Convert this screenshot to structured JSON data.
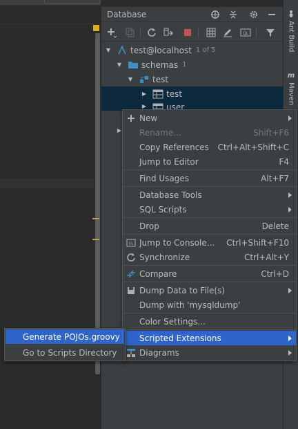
{
  "panel": {
    "title": "Database"
  },
  "tree": [
    {
      "label": "test@localhost",
      "count": "1 of 5",
      "icon": "datasource-icon"
    },
    {
      "label": "schemas",
      "count": "1",
      "icon": "folder-icon"
    },
    {
      "label": "test",
      "count": "",
      "icon": "schema-icon"
    },
    {
      "label": "test",
      "count": "",
      "icon": "table-icon"
    },
    {
      "label": "user",
      "count": "",
      "icon": "table-icon"
    }
  ],
  "side_tabs": {
    "ant": "Ant Build",
    "maven": "Maven"
  },
  "context_menu": {
    "items": [
      {
        "label": "New",
        "shortcut": "",
        "submenu": true,
        "icon": "plus-icon"
      },
      {
        "label": "Rename...",
        "shortcut": "Shift+F6",
        "disabled": true
      },
      {
        "label": "Copy References",
        "shortcut": "Ctrl+Alt+Shift+C"
      },
      {
        "label": "Jump to Editor",
        "shortcut": "F4"
      },
      {
        "label": "Find Usages",
        "shortcut": "Alt+F7"
      },
      {
        "label": "Database Tools",
        "shortcut": "",
        "submenu": true
      },
      {
        "label": "SQL Scripts",
        "shortcut": "",
        "submenu": true
      },
      {
        "label": "Drop",
        "shortcut": "Delete"
      },
      {
        "label": "Jump to Console...",
        "shortcut": "Ctrl+Shift+F10",
        "icon": "console-icon"
      },
      {
        "label": "Synchronize",
        "shortcut": "Ctrl+Alt+Y",
        "icon": "sync-icon"
      },
      {
        "label": "Compare",
        "shortcut": "Ctrl+D",
        "icon": "compare-icon"
      },
      {
        "label": "Dump Data to File(s)",
        "shortcut": "",
        "submenu": true,
        "icon": "dump-icon"
      },
      {
        "label": "Dump with 'mysqldump'",
        "shortcut": ""
      },
      {
        "label": "Color Settings...",
        "shortcut": ""
      },
      {
        "label": "Scripted Extensions",
        "shortcut": "",
        "submenu": true,
        "active": true
      },
      {
        "label": "Diagrams",
        "shortcut": "",
        "submenu": true,
        "icon": "diagram-icon"
      }
    ]
  },
  "scripted_submenu": {
    "items": [
      {
        "label": "Generate POJOs.groovy",
        "active": true
      },
      {
        "label": "Go to Scripts Directory"
      }
    ]
  },
  "colors": {
    "selection": "#2f65ca",
    "tree_selection": "#0d293e",
    "panel_bg": "#3c3f41",
    "editor_bg": "#2b2b2b",
    "stop_red": "#c75450",
    "folder_blue": "#3d8fc4"
  }
}
